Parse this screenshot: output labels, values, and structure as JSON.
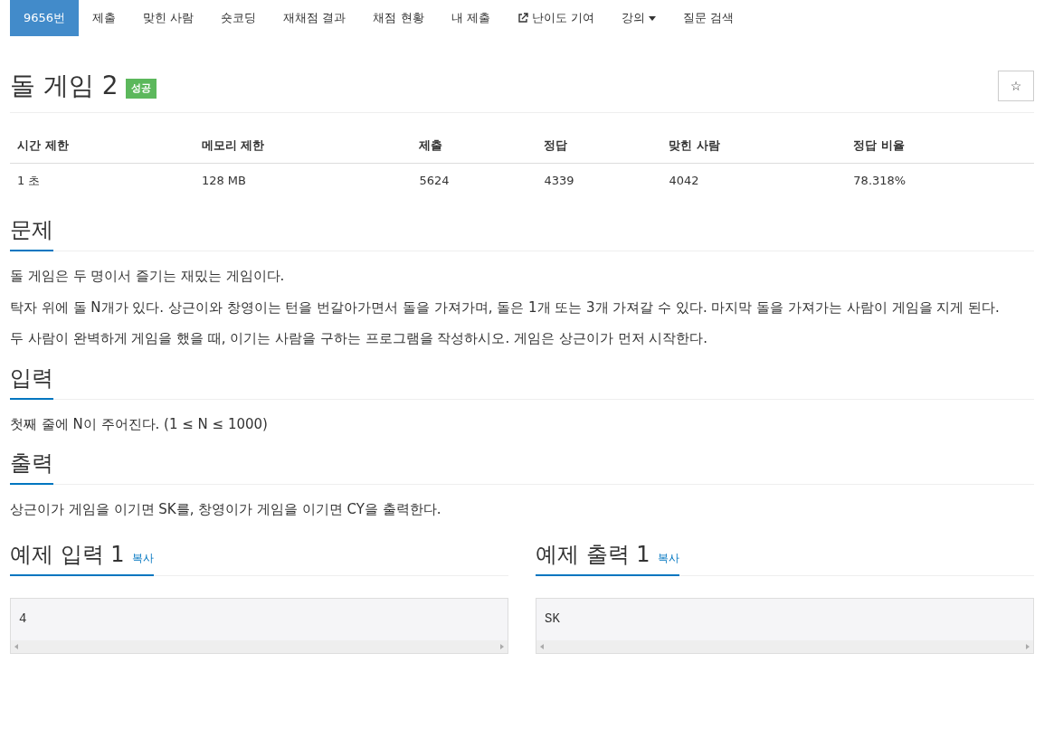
{
  "nav": [
    {
      "label": "9656번",
      "selected": true,
      "kind": "plain"
    },
    {
      "label": "제출",
      "selected": false,
      "kind": "plain"
    },
    {
      "label": "맞힌 사람",
      "selected": false,
      "kind": "plain"
    },
    {
      "label": "숏코딩",
      "selected": false,
      "kind": "plain"
    },
    {
      "label": "재채점 결과",
      "selected": false,
      "kind": "plain"
    },
    {
      "label": "채점 현황",
      "selected": false,
      "kind": "plain"
    },
    {
      "label": "내 제출",
      "selected": false,
      "kind": "plain"
    },
    {
      "label": "난이도 기여",
      "selected": false,
      "kind": "external"
    },
    {
      "label": "강의",
      "selected": false,
      "kind": "dropdown"
    },
    {
      "label": "질문 검색",
      "selected": false,
      "kind": "plain"
    }
  ],
  "title": "돌 게임 2",
  "badge": "성공",
  "star_button": "☆",
  "info_table": {
    "columns": [
      "시간 제한",
      "메모리 제한",
      "제출",
      "정답",
      "맞힌 사람",
      "정답 비율"
    ],
    "rows": [
      [
        "1 초",
        "128 MB",
        "5624",
        "4339",
        "4042",
        "78.318%"
      ]
    ]
  },
  "sections": [
    {
      "heading": "문제",
      "paragraphs": [
        "돌 게임은 두 명이서 즐기는 재밌는 게임이다.",
        "탁자 위에 돌 N개가 있다. 상근이와 창영이는 턴을 번갈아가면서 돌을 가져가며, 돌은 1개 또는 3개 가져갈 수 있다. 마지막 돌을 가져가는 사람이 게임을 지게 된다.",
        "두 사람이 완벽하게 게임을 했을 때, 이기는 사람을 구하는 프로그램을 작성하시오. 게임은 상근이가 먼저 시작한다."
      ]
    },
    {
      "heading": "입력",
      "paragraphs": [
        "첫째 줄에 N이 주어진다. (1 ≤ N ≤ 1000)"
      ]
    },
    {
      "heading": "출력",
      "paragraphs": [
        "상근이가 게임을 이기면 SK를, 창영이가 게임을 이기면 CY을 출력한다."
      ]
    }
  ],
  "samples": [
    {
      "heading": "예제 입력 1",
      "copy": "복사",
      "content": "4"
    },
    {
      "heading": "예제 출력 1",
      "copy": "복사",
      "content": "SK"
    }
  ]
}
